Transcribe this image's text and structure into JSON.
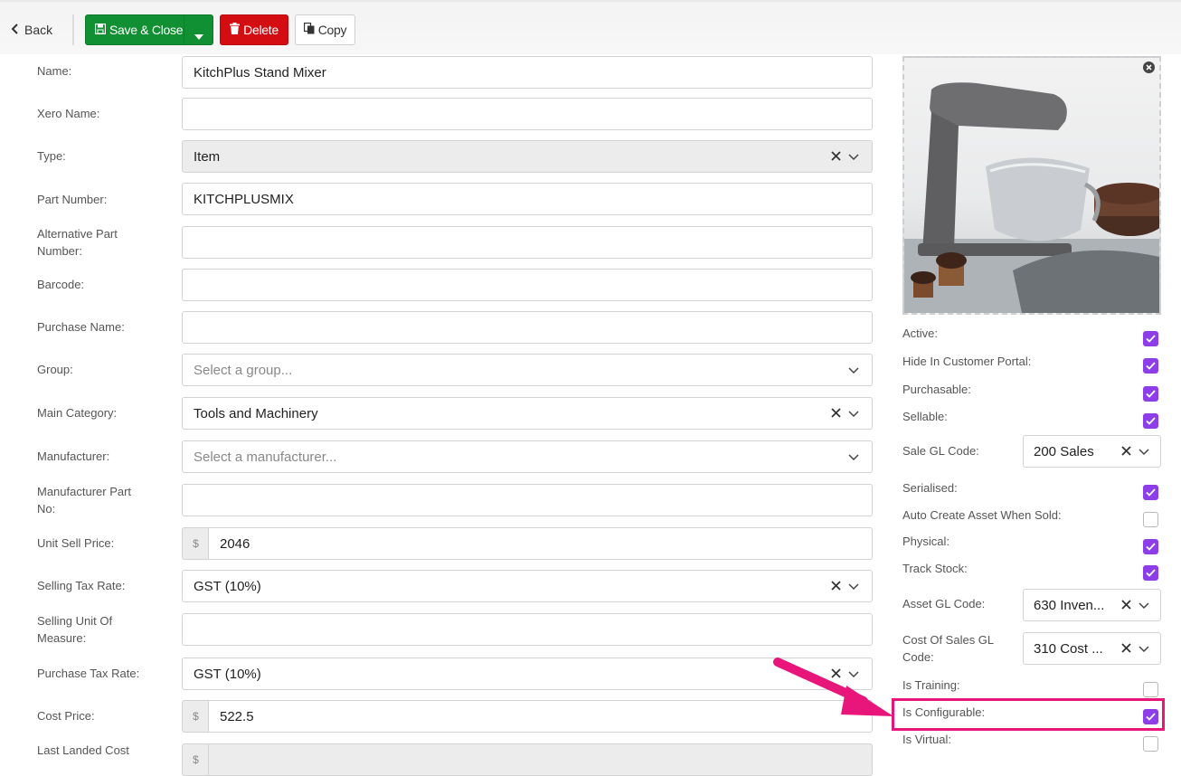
{
  "toolbar": {
    "back_label": "Back",
    "save_close_label": "Save & Close",
    "delete_label": "Delete",
    "copy_label": "Copy"
  },
  "form": {
    "name": {
      "label": "Name:",
      "value": "KitchPlus Stand Mixer"
    },
    "xero_name": {
      "label": "Xero Name:",
      "value": ""
    },
    "type": {
      "label": "Type:",
      "value": "Item"
    },
    "part_number": {
      "label": "Part Number:",
      "value": "KITCHPLUSMIX"
    },
    "alt_part_number": {
      "label": "Alternative Part Number:",
      "value": ""
    },
    "barcode": {
      "label": "Barcode:",
      "value": ""
    },
    "purchase_name": {
      "label": "Purchase Name:",
      "value": ""
    },
    "group": {
      "label": "Group:",
      "placeholder": "Select a group..."
    },
    "main_category": {
      "label": "Main Category:",
      "value": "Tools and Machinery"
    },
    "manufacturer": {
      "label": "Manufacturer:",
      "placeholder": "Select a manufacturer..."
    },
    "manufacturer_part_no": {
      "label": "Manufacturer Part No:",
      "value": ""
    },
    "unit_sell_price": {
      "label": "Unit Sell Price:",
      "prefix": "$",
      "value": "2046"
    },
    "selling_tax_rate": {
      "label": "Selling Tax Rate:",
      "value": "GST (10%)"
    },
    "selling_uom": {
      "label": "Selling Unit Of Measure:",
      "value": ""
    },
    "purchase_tax_rate": {
      "label": "Purchase Tax Rate:",
      "value": "GST (10%)"
    },
    "cost_price": {
      "label": "Cost Price:",
      "prefix": "$",
      "value": "522.5"
    },
    "last_landed_cost": {
      "label": "Last Landed Cost",
      "prefix": "$"
    }
  },
  "side": {
    "active": {
      "label": "Active:",
      "checked": true
    },
    "hide_in_portal": {
      "label": "Hide In Customer Portal:",
      "checked": true
    },
    "purchasable": {
      "label": "Purchasable:",
      "checked": true
    },
    "sellable": {
      "label": "Sellable:",
      "checked": true
    },
    "sale_gl_code": {
      "label": "Sale GL Code:",
      "value": "200 Sales"
    },
    "serialised": {
      "label": "Serialised:",
      "checked": true
    },
    "auto_create_asset": {
      "label": "Auto Create Asset When Sold:",
      "checked": false
    },
    "physical": {
      "label": "Physical:",
      "checked": true
    },
    "track_stock": {
      "label": "Track Stock:",
      "checked": true
    },
    "asset_gl_code": {
      "label": "Asset GL Code:",
      "value": "630 Inven..."
    },
    "cost_of_sales_gl_code": {
      "label": "Cost Of Sales GL Code:",
      "value": "310 Cost ..."
    },
    "is_training": {
      "label": "Is Training:",
      "checked": false
    },
    "is_configurable": {
      "label": "Is Configurable:",
      "checked": true
    },
    "is_virtual": {
      "label": "Is Virtual:",
      "checked": false
    }
  },
  "colors": {
    "save": "#118f33",
    "delete": "#d40d12",
    "checkbox_on": "#8e3ee8",
    "highlight": "#e8157a"
  }
}
